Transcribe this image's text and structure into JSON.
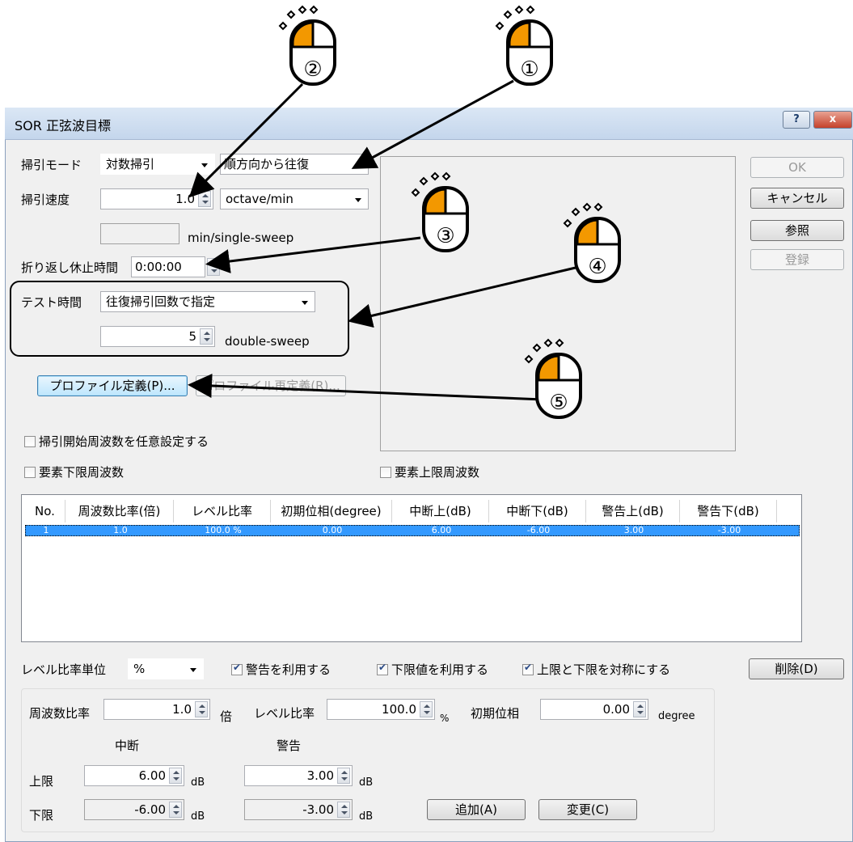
{
  "window": {
    "title": "SOR 正弦波目標",
    "help_label": "?",
    "close_label": "x"
  },
  "sweep_mode": {
    "label": "掃引モード",
    "value": "対数掃引",
    "direction_value": "順方向から往復"
  },
  "sweep_speed": {
    "label": "掃引速度",
    "value": "1.0",
    "unit_value": "octave/min"
  },
  "single_sweep": {
    "value": "",
    "unit": "min/single-sweep"
  },
  "turnaround": {
    "label": "折り返し休止時間",
    "value": "0:00:00"
  },
  "test_time": {
    "label": "テスト時間",
    "value": "往復掃引回数で指定",
    "count": "5",
    "count_unit": "double-sweep"
  },
  "buttons": {
    "profile_define": "プロファイル定義(P)...",
    "profile_redefine": "プロファイル再定義(R)...",
    "ok": "OK",
    "cancel": "キャンセル",
    "browse": "参照",
    "register": "登録",
    "delete": "削除(D)",
    "add": "追加(A)",
    "change": "変更(C)"
  },
  "checkboxes": {
    "start_freq": "掃引開始周波数を任意設定する",
    "lower_freq": "要素下限周波数",
    "upper_freq": "要素上限周波数",
    "use_warning": "警告を利用する",
    "use_lower": "下限値を利用する",
    "symmetric": "上限と下限を対称にする"
  },
  "table": {
    "headers": [
      "No.",
      "周波数比率(倍)",
      "レベル比率",
      "初期位相(degree)",
      "中断上(dB)",
      "中断下(dB)",
      "警告上(dB)",
      "警告下(dB)"
    ],
    "rows": [
      [
        "1",
        "1.0",
        "100.0 %",
        "0.00",
        "6.00",
        "-6.00",
        "3.00",
        "-3.00"
      ]
    ]
  },
  "level_unit": {
    "label": "レベル比率単位",
    "value": "%"
  },
  "editor": {
    "freq_ratio_label": "周波数比率",
    "freq_ratio_value": "1.0",
    "freq_ratio_unit": "倍",
    "level_ratio_label": "レベル比率",
    "level_ratio_value": "100.0",
    "level_ratio_unit": "%",
    "phase_label": "初期位相",
    "phase_value": "0.00",
    "phase_unit": "degree",
    "abort_header": "中断",
    "warn_header": "警告",
    "upper_label": "上限",
    "lower_label": "下限",
    "abort_upper": "6.00",
    "abort_lower": "-6.00",
    "warn_upper": "3.00",
    "warn_lower": "-3.00",
    "db": "dB"
  },
  "callouts": [
    "②",
    "①",
    "③",
    "④",
    "⑤"
  ],
  "colors": {
    "accent_orange": "#f39800",
    "selection_blue": "#3399ff"
  }
}
